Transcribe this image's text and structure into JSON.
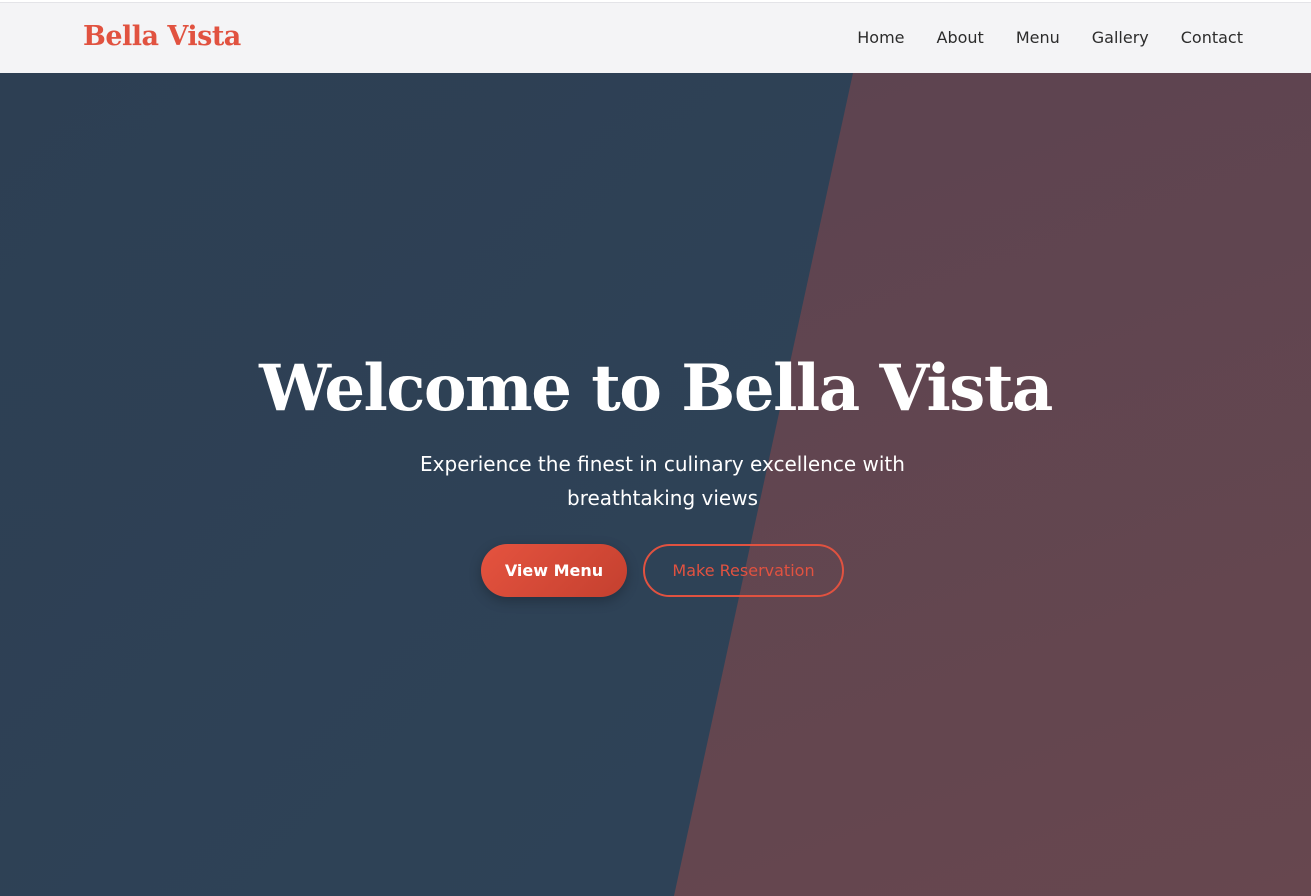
{
  "brand": {
    "name": "Bella Vista",
    "color": "#e15240"
  },
  "nav": {
    "items": [
      {
        "label": "Home"
      },
      {
        "label": "About"
      },
      {
        "label": "Menu"
      },
      {
        "label": "Gallery"
      },
      {
        "label": "Contact"
      }
    ]
  },
  "hero": {
    "title": "Welcome to Bella Vista",
    "subtitle": "Experience the finest in culinary excellence with breathtaking views",
    "primary_button": "View Menu",
    "secondary_button": "Make Reservation",
    "colors": {
      "base": "#2e4155",
      "overlay": "#5f4550",
      "accent": "#e15240"
    }
  }
}
